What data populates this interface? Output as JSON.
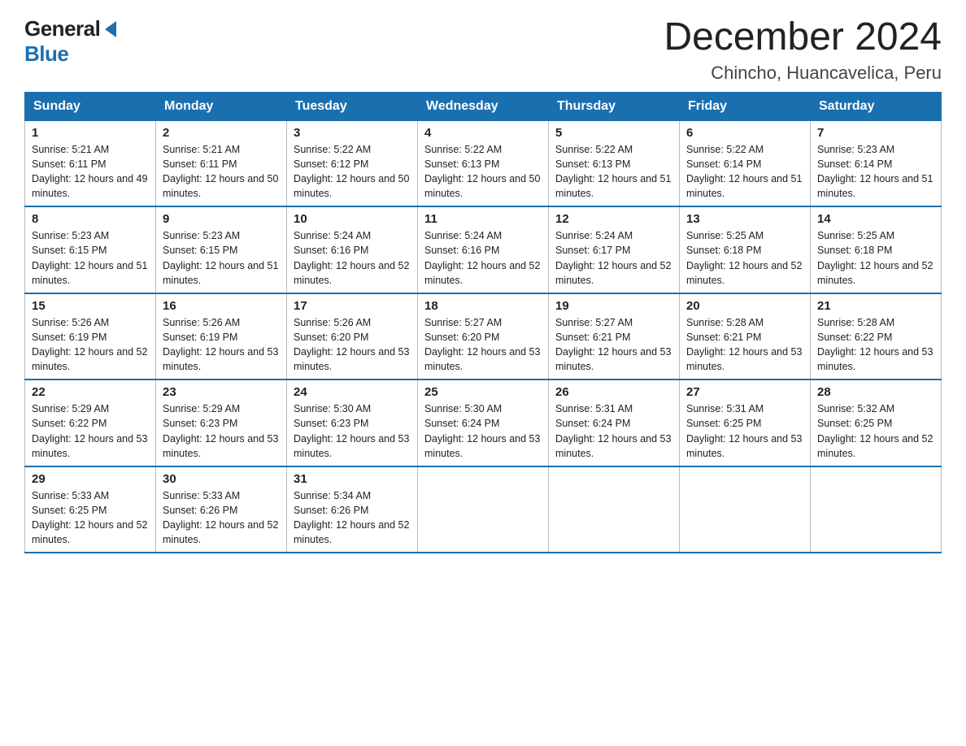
{
  "logo": {
    "general": "General",
    "blue": "Blue"
  },
  "title": "December 2024",
  "subtitle": "Chincho, Huancavelica, Peru",
  "headers": [
    "Sunday",
    "Monday",
    "Tuesday",
    "Wednesday",
    "Thursday",
    "Friday",
    "Saturday"
  ],
  "weeks": [
    [
      {
        "day": "1",
        "sunrise": "5:21 AM",
        "sunset": "6:11 PM",
        "daylight": "12 hours and 49 minutes."
      },
      {
        "day": "2",
        "sunrise": "5:21 AM",
        "sunset": "6:11 PM",
        "daylight": "12 hours and 50 minutes."
      },
      {
        "day": "3",
        "sunrise": "5:22 AM",
        "sunset": "6:12 PM",
        "daylight": "12 hours and 50 minutes."
      },
      {
        "day": "4",
        "sunrise": "5:22 AM",
        "sunset": "6:13 PM",
        "daylight": "12 hours and 50 minutes."
      },
      {
        "day": "5",
        "sunrise": "5:22 AM",
        "sunset": "6:13 PM",
        "daylight": "12 hours and 51 minutes."
      },
      {
        "day": "6",
        "sunrise": "5:22 AM",
        "sunset": "6:14 PM",
        "daylight": "12 hours and 51 minutes."
      },
      {
        "day": "7",
        "sunrise": "5:23 AM",
        "sunset": "6:14 PM",
        "daylight": "12 hours and 51 minutes."
      }
    ],
    [
      {
        "day": "8",
        "sunrise": "5:23 AM",
        "sunset": "6:15 PM",
        "daylight": "12 hours and 51 minutes."
      },
      {
        "day": "9",
        "sunrise": "5:23 AM",
        "sunset": "6:15 PM",
        "daylight": "12 hours and 51 minutes."
      },
      {
        "day": "10",
        "sunrise": "5:24 AM",
        "sunset": "6:16 PM",
        "daylight": "12 hours and 52 minutes."
      },
      {
        "day": "11",
        "sunrise": "5:24 AM",
        "sunset": "6:16 PM",
        "daylight": "12 hours and 52 minutes."
      },
      {
        "day": "12",
        "sunrise": "5:24 AM",
        "sunset": "6:17 PM",
        "daylight": "12 hours and 52 minutes."
      },
      {
        "day": "13",
        "sunrise": "5:25 AM",
        "sunset": "6:18 PM",
        "daylight": "12 hours and 52 minutes."
      },
      {
        "day": "14",
        "sunrise": "5:25 AM",
        "sunset": "6:18 PM",
        "daylight": "12 hours and 52 minutes."
      }
    ],
    [
      {
        "day": "15",
        "sunrise": "5:26 AM",
        "sunset": "6:19 PM",
        "daylight": "12 hours and 52 minutes."
      },
      {
        "day": "16",
        "sunrise": "5:26 AM",
        "sunset": "6:19 PM",
        "daylight": "12 hours and 53 minutes."
      },
      {
        "day": "17",
        "sunrise": "5:26 AM",
        "sunset": "6:20 PM",
        "daylight": "12 hours and 53 minutes."
      },
      {
        "day": "18",
        "sunrise": "5:27 AM",
        "sunset": "6:20 PM",
        "daylight": "12 hours and 53 minutes."
      },
      {
        "day": "19",
        "sunrise": "5:27 AM",
        "sunset": "6:21 PM",
        "daylight": "12 hours and 53 minutes."
      },
      {
        "day": "20",
        "sunrise": "5:28 AM",
        "sunset": "6:21 PM",
        "daylight": "12 hours and 53 minutes."
      },
      {
        "day": "21",
        "sunrise": "5:28 AM",
        "sunset": "6:22 PM",
        "daylight": "12 hours and 53 minutes."
      }
    ],
    [
      {
        "day": "22",
        "sunrise": "5:29 AM",
        "sunset": "6:22 PM",
        "daylight": "12 hours and 53 minutes."
      },
      {
        "day": "23",
        "sunrise": "5:29 AM",
        "sunset": "6:23 PM",
        "daylight": "12 hours and 53 minutes."
      },
      {
        "day": "24",
        "sunrise": "5:30 AM",
        "sunset": "6:23 PM",
        "daylight": "12 hours and 53 minutes."
      },
      {
        "day": "25",
        "sunrise": "5:30 AM",
        "sunset": "6:24 PM",
        "daylight": "12 hours and 53 minutes."
      },
      {
        "day": "26",
        "sunrise": "5:31 AM",
        "sunset": "6:24 PM",
        "daylight": "12 hours and 53 minutes."
      },
      {
        "day": "27",
        "sunrise": "5:31 AM",
        "sunset": "6:25 PM",
        "daylight": "12 hours and 53 minutes."
      },
      {
        "day": "28",
        "sunrise": "5:32 AM",
        "sunset": "6:25 PM",
        "daylight": "12 hours and 52 minutes."
      }
    ],
    [
      {
        "day": "29",
        "sunrise": "5:33 AM",
        "sunset": "6:25 PM",
        "daylight": "12 hours and 52 minutes."
      },
      {
        "day": "30",
        "sunrise": "5:33 AM",
        "sunset": "6:26 PM",
        "daylight": "12 hours and 52 minutes."
      },
      {
        "day": "31",
        "sunrise": "5:34 AM",
        "sunset": "6:26 PM",
        "daylight": "12 hours and 52 minutes."
      },
      null,
      null,
      null,
      null
    ]
  ]
}
